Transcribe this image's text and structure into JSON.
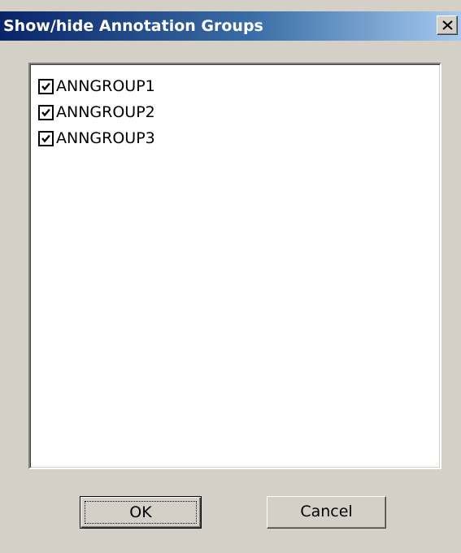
{
  "window": {
    "title": "Show/hide Annotation Groups",
    "close_icon": "close-icon"
  },
  "groups": [
    {
      "label": "ANNGROUP1",
      "checked": true
    },
    {
      "label": "ANNGROUP2",
      "checked": true
    },
    {
      "label": "ANNGROUP3",
      "checked": true
    }
  ],
  "buttons": {
    "ok_label": "OK",
    "cancel_label": "Cancel"
  },
  "colors": {
    "titlebar_start": "#0a246a",
    "titlebar_end": "#a6caf0",
    "dialog_face": "#d4d0c8"
  }
}
